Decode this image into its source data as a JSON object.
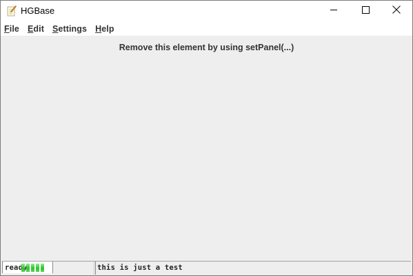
{
  "window": {
    "title": "HGBase"
  },
  "menu": {
    "items": [
      {
        "label_mnemonic": "F",
        "label_rest": "ile"
      },
      {
        "label_mnemonic": "E",
        "label_rest": "dit"
      },
      {
        "label_mnemonic": "S",
        "label_rest": "ettings"
      },
      {
        "label_mnemonic": "H",
        "label_rest": "elp"
      }
    ]
  },
  "content": {
    "placeholder_text": "Remove this element by using setPanel(...)"
  },
  "statusbar": {
    "left_text": "ready",
    "middle_text": "this is just a test",
    "progress": {
      "style": "indeterminate",
      "block_count": 5,
      "block_color": "#2fc22f"
    }
  },
  "icons": {
    "app_icon": "notepad-pencil-icon",
    "minimize": "minimize-icon",
    "maximize": "maximize-icon",
    "close": "close-icon"
  },
  "colors": {
    "background": "#eeeeee",
    "titlebar": "#ffffff",
    "text": "#333333",
    "progress": "#2fc22f"
  }
}
